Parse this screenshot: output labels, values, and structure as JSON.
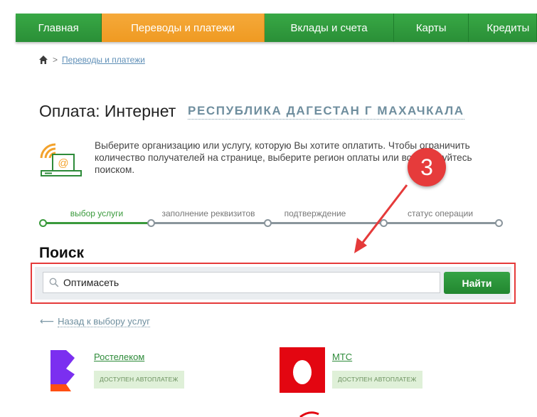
{
  "nav": {
    "items": [
      {
        "label": "Главная",
        "active": false
      },
      {
        "label": "Переводы и платежи",
        "active": true
      },
      {
        "label": "Вклады и счета",
        "active": false
      },
      {
        "label": "Карты",
        "active": false
      },
      {
        "label": "Кредиты",
        "active": false
      }
    ]
  },
  "breadcrumb": {
    "home_icon": "home-icon",
    "separator": ">",
    "link": "Переводы и платежи"
  },
  "page": {
    "title": "Оплата: Интернет",
    "region": "РЕСПУБЛИКА ДАГЕСТАН Г МАХАЧКАЛА",
    "info_text": "Выберите организацию или услугу, которую Вы хотите оплатить. Чтобы ограничить количество получателей на странице, выберите регион оплаты или воспользуйтесь поиском."
  },
  "steps": [
    {
      "label": "выбор услуги",
      "active": true
    },
    {
      "label": "заполнение реквизитов",
      "active": false
    },
    {
      "label": "подтверждение",
      "active": false
    },
    {
      "label": "статус операции",
      "active": false
    }
  ],
  "search": {
    "title": "Поиск",
    "value": "Оптимасеть",
    "button": "Найти"
  },
  "back_link": "Назад к выбору услуг",
  "providers": [
    {
      "name": "Ростелеком",
      "badge": "ДОСТУПЕН АВТОПЛАТЕЖ",
      "logo": "rostelecom-logo"
    },
    {
      "name": "МТС",
      "badge": "ДОСТУПЕН АВТОПЛАТЕЖ",
      "logo": "mts-logo"
    }
  ],
  "annotation": {
    "number": "3"
  },
  "colors": {
    "nav_green": "#2f9a3c",
    "nav_active_orange": "#ef9a22",
    "accent_green": "#3a9a3c",
    "annotation_red": "#e53a3a",
    "mts_red": "#e30611"
  }
}
